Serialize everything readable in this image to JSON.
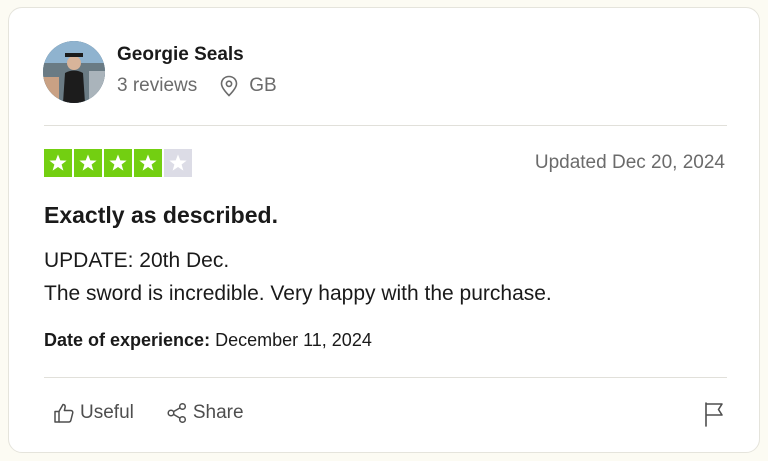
{
  "reviewer": {
    "name": "Georgie Seals",
    "review_count": "3 reviews",
    "country": "GB"
  },
  "review": {
    "rating": 4,
    "max_rating": 5,
    "updated": "Updated Dec 20, 2024",
    "title": "Exactly as described.",
    "body_line_1": "UPDATE: 20th Dec.",
    "body_line_2": "The sword is incredible. Very happy with the purchase.",
    "experience_label": "Date of experience:",
    "experience_date": "December 11, 2024"
  },
  "actions": {
    "useful_label": "Useful",
    "share_label": "Share"
  },
  "colors": {
    "star_filled": "#73cf11",
    "star_empty": "#dcdce6"
  },
  "icons": [
    "location-pin-icon",
    "star-icon",
    "thumbs-up-icon",
    "share-icon",
    "flag-icon"
  ]
}
